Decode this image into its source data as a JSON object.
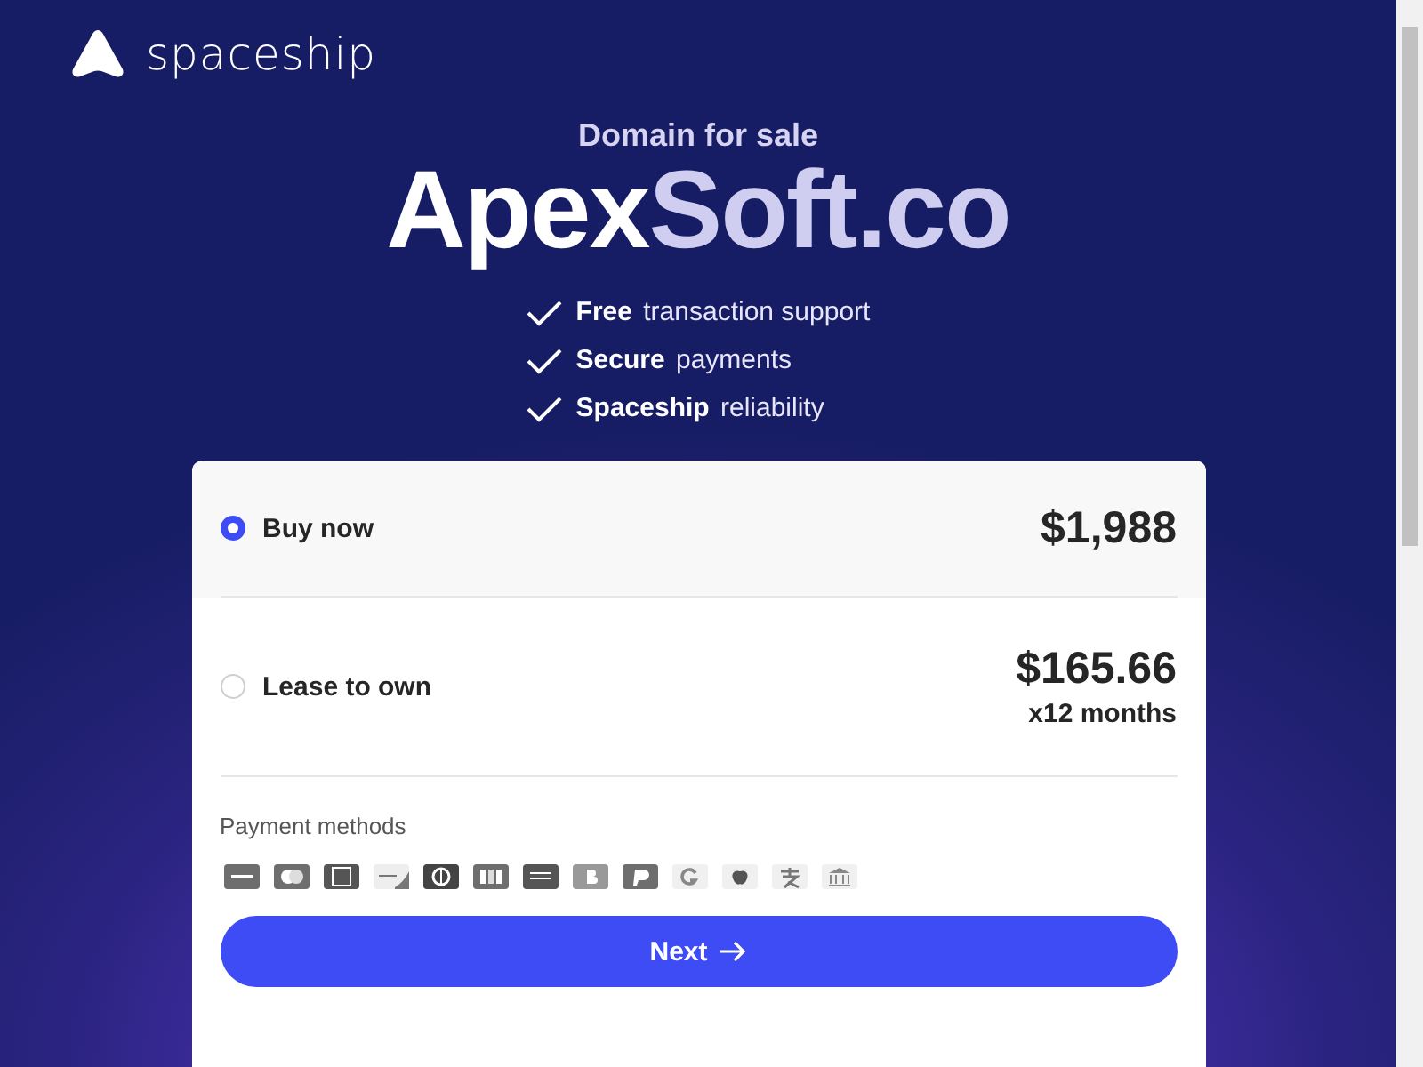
{
  "brand": {
    "name": "spaceship"
  },
  "hero": {
    "kicker": "Domain for sale",
    "domain": "Apex**Soft.co**"
  },
  "features": [
    "**Free** transaction support",
    "**Secure** payments",
    "**Spaceship** reliability"
  ],
  "options": [
    {
      "label": "Buy now",
      "price": "$1,988",
      "selected": true
    },
    {
      "label": "Lease to own",
      "price": "$165.66",
      "term": "x12 months",
      "selected": false
    }
  ],
  "payment_methods": {
    "label": "Payment methods"
  },
  "next_button": {
    "label": "Next"
  }
}
